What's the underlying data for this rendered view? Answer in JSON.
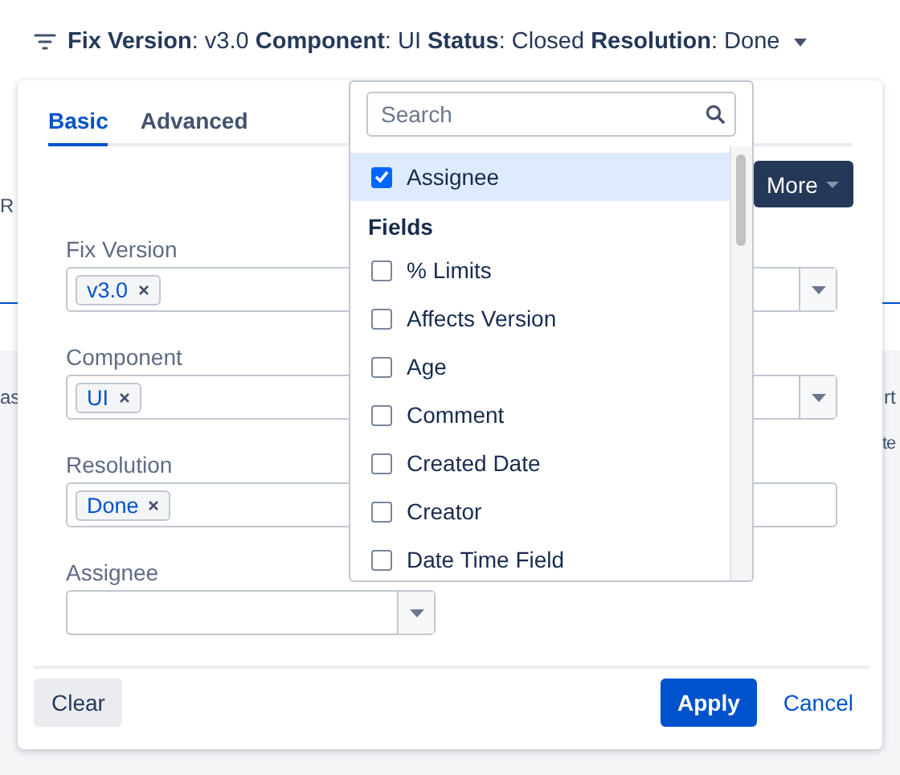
{
  "filter_summary": {
    "text": "**Fix Version**: v3.0 **Component**: UI **Status**: Closed **Resolution**: Done"
  },
  "background": {
    "fragments": [
      "R",
      "as",
      "rt",
      "te"
    ],
    "more_button": "More"
  },
  "panel": {
    "tabs": [
      {
        "label": "Basic",
        "selected": true
      },
      {
        "label": "Advanced",
        "selected": false
      }
    ],
    "fields": [
      {
        "label": "Fix Version",
        "kind": "tags",
        "tags": [
          "v3.0"
        ],
        "dropdown": true
      },
      {
        "label": "Component",
        "kind": "tags",
        "tags": [
          "UI"
        ],
        "dropdown": true
      },
      {
        "label": "Resolution",
        "kind": "tags",
        "tags": [
          "Done"
        ],
        "dropdown": false
      },
      {
        "label": "Assignee",
        "kind": "select",
        "dropdown": true
      }
    ],
    "clear_button": "Clear",
    "apply_button": "Apply",
    "cancel_link": "Cancel"
  },
  "field_picker": {
    "search": {
      "placeholder": "Search"
    },
    "items": [
      {
        "kind": "option",
        "label": "Assignee",
        "checked": true,
        "selected": true
      },
      {
        "kind": "heading",
        "label": "Fields"
      },
      {
        "kind": "option",
        "label": "% Limits",
        "checked": false,
        "selected": false
      },
      {
        "kind": "option",
        "label": "Affects Version",
        "checked": false,
        "selected": false
      },
      {
        "kind": "option",
        "label": "Age",
        "checked": false,
        "selected": false
      },
      {
        "kind": "option",
        "label": "Comment",
        "checked": false,
        "selected": false
      },
      {
        "kind": "option",
        "label": "Created Date",
        "checked": false,
        "selected": false
      },
      {
        "kind": "option",
        "label": "Creator",
        "checked": false,
        "selected": false
      },
      {
        "kind": "option",
        "label": "Date Time Field",
        "checked": false,
        "selected": false
      }
    ]
  }
}
